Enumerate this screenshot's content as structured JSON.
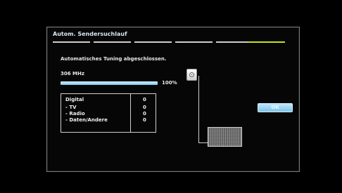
{
  "dialog": {
    "title": "Autom. Sendersuchlauf",
    "steps": [
      {
        "active": false
      },
      {
        "active": false
      },
      {
        "active": false
      },
      {
        "active": false
      },
      {
        "active": false
      },
      {
        "active": true
      }
    ],
    "accent_color": "#c7e21b"
  },
  "scan": {
    "status": "Automatisches Tuning abgeschlossen.",
    "frequency": "306 MHz",
    "progress_percent": 100,
    "progress_label": "100%",
    "progress_color": "#7fc8ec"
  },
  "results": {
    "rows": [
      {
        "label": "Digital",
        "value": "0"
      },
      {
        "label": "- TV",
        "value": "0"
      },
      {
        "label": "- Radio",
        "value": "0"
      },
      {
        "label": "- Daten/Andere",
        "value": "0"
      }
    ]
  },
  "icons": {
    "antenna": "antenna-socket-icon",
    "tv": "tv-screen-icon"
  },
  "actions": {
    "ok_label": "OK"
  }
}
